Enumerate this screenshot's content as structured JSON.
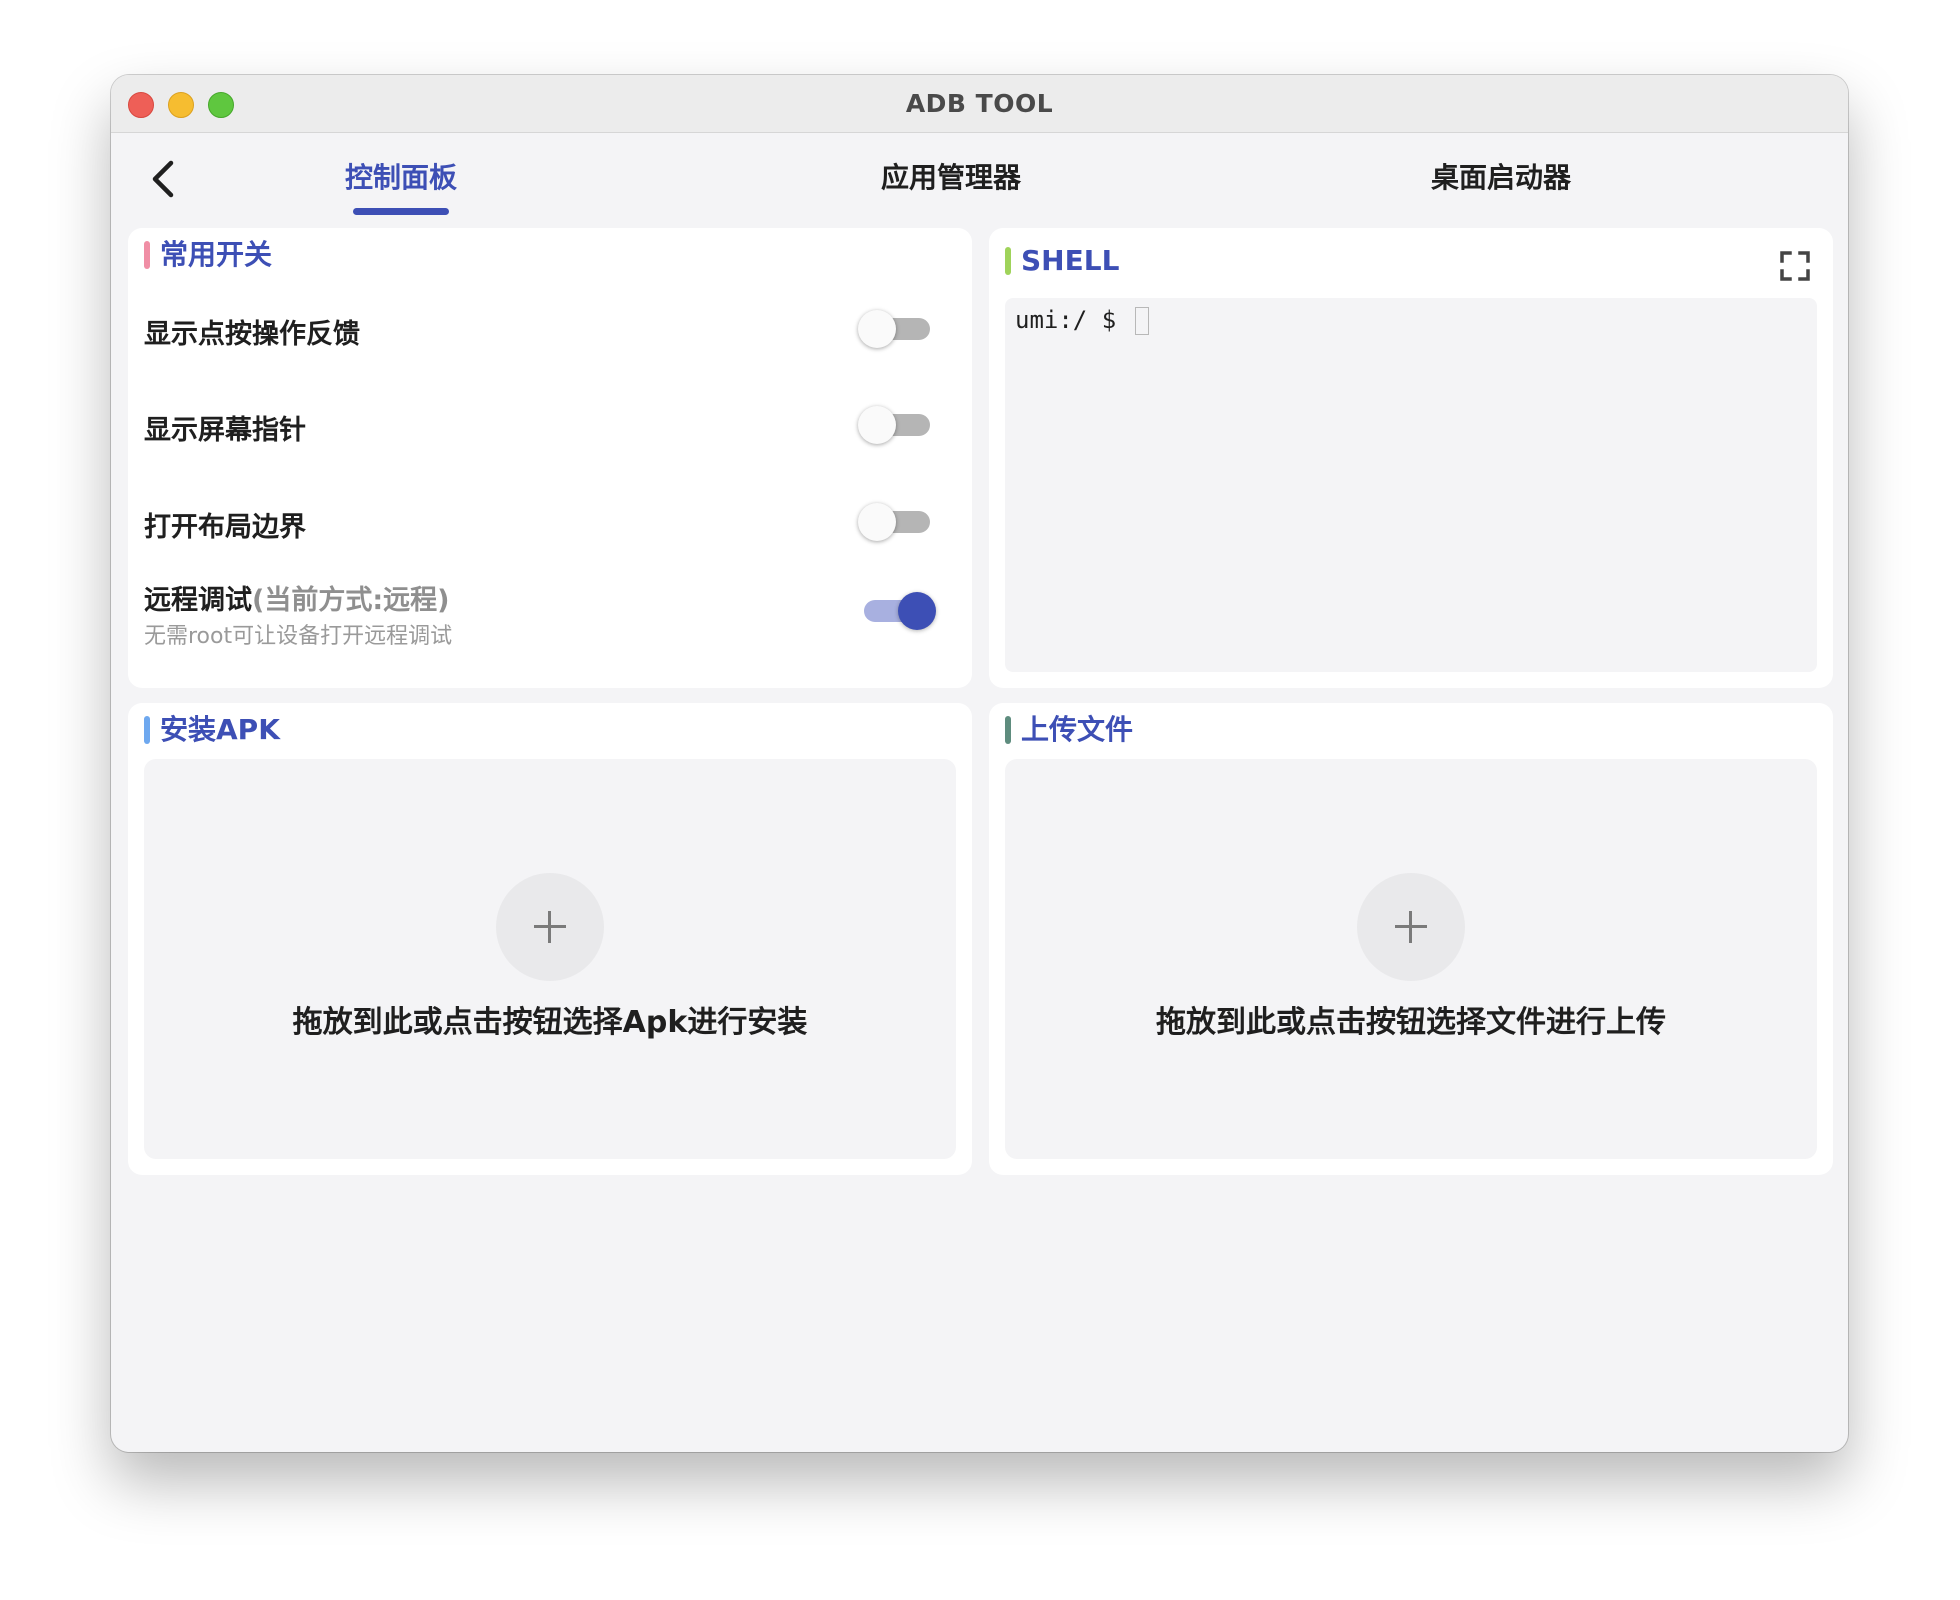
{
  "window": {
    "title": "ADB TOOL"
  },
  "nav": {
    "back_icon": "chevron-left-icon",
    "tabs": [
      {
        "label": "控制面板",
        "active": true
      },
      {
        "label": "应用管理器",
        "active": false
      },
      {
        "label": "桌面启动器",
        "active": false
      }
    ]
  },
  "switches_card": {
    "title": "常用开关",
    "accent": "#f08ea5",
    "items": [
      {
        "label": "显示点按操作反馈",
        "on": false
      },
      {
        "label": "显示屏幕指针",
        "on": false
      },
      {
        "label": "打开布局边界",
        "on": false
      },
      {
        "label": "远程调试",
        "label_extra": "(当前方式:远程)",
        "sub": "无需root可让设备打开远程调试",
        "on": true
      }
    ]
  },
  "shell_card": {
    "title": "SHELL",
    "accent": "#9fd35a",
    "prompt": "umi:/ $ ",
    "fullscreen_icon": "fullscreen-icon"
  },
  "apk_card": {
    "title": "安装APK",
    "accent": "#6ea8ef",
    "drop_text": "拖放到此或点击按钮选择Apk进行安装",
    "add_icon": "plus-icon"
  },
  "upload_card": {
    "title": "上传文件",
    "accent": "#5e8c7e",
    "drop_text": "拖放到此或点击按钮选择文件进行上传",
    "add_icon": "plus-icon"
  },
  "colors": {
    "primary": "#3d4fb5",
    "background": "#f4f4f6"
  }
}
